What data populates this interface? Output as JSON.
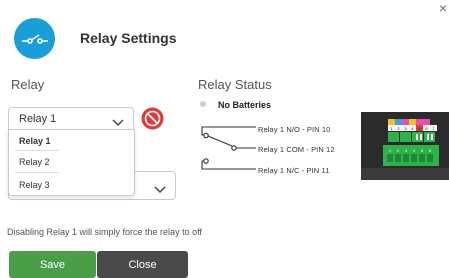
{
  "dialog": {
    "close_glyph": "×",
    "title": "Relay Settings",
    "icon": "relay-switch-icon",
    "accent_color": "#1a9ed9"
  },
  "relay": {
    "section_label": "Relay",
    "selected": "Relay 1",
    "options": [
      "Relay 1",
      "Relay 2",
      "Relay 3"
    ],
    "disabled_icon": "no-entry-icon"
  },
  "status": {
    "section_label": "Relay Status",
    "battery_text": "No Batteries",
    "pins": [
      "Relay 1 N/O - PIN 10",
      "Relay 1 COM - PIN 12",
      "Relay 1 N/C - PIN 11"
    ],
    "terminal_top": [
      "1",
      "2",
      "3",
      "4",
      "5",
      "6",
      "7"
    ],
    "terminal_bottom": [
      "1",
      "2",
      "3",
      "4",
      "5",
      "6"
    ]
  },
  "note": "Disabling Relay 1 will simply force the relay to off",
  "buttons": {
    "save": "Save",
    "close": "Close",
    "save_color": "#4a9e48",
    "close_color": "#4a4a4a"
  }
}
